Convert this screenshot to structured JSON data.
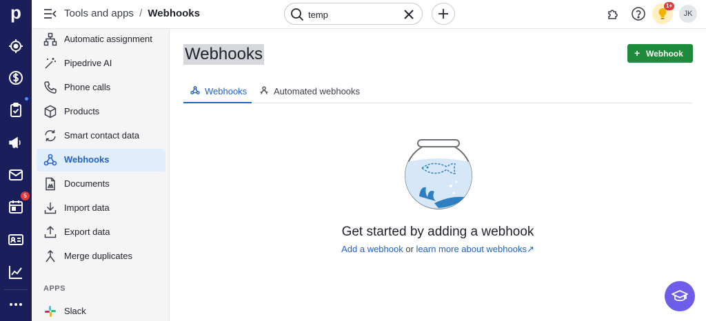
{
  "rail": {
    "logo": "p",
    "items": [
      {
        "icon": "target-icon"
      },
      {
        "icon": "dollar-icon"
      },
      {
        "icon": "clipboard-check-icon"
      },
      {
        "icon": "megaphone-icon"
      },
      {
        "icon": "mail-icon"
      },
      {
        "icon": "calendar-icon",
        "badge": "5"
      },
      {
        "icon": "contact-card-icon"
      },
      {
        "icon": "chart-icon"
      },
      {
        "icon": "more-icon"
      }
    ]
  },
  "header": {
    "breadcrumb_parent": "Tools and apps",
    "breadcrumb_separator": "/",
    "breadcrumb_current": "Webhooks",
    "search_value": "temp",
    "notification_badge": "1+",
    "avatar_initials": "JK"
  },
  "sidebar": {
    "items": [
      {
        "label": "Automatic assignment",
        "icon": "hierarchy-icon"
      },
      {
        "label": "Pipedrive AI",
        "icon": "magic-wand-icon"
      },
      {
        "label": "Phone calls",
        "icon": "phone-icon"
      },
      {
        "label": "Products",
        "icon": "box-icon"
      },
      {
        "label": "Smart contact data",
        "icon": "sync-icon"
      },
      {
        "label": "Webhooks",
        "icon": "webhook-icon",
        "active": true
      },
      {
        "label": "Documents",
        "icon": "document-icon"
      },
      {
        "label": "Import data",
        "icon": "download-icon"
      },
      {
        "label": "Export data",
        "icon": "upload-icon"
      },
      {
        "label": "Merge duplicates",
        "icon": "merge-icon"
      }
    ],
    "apps_heading": "APPS",
    "apps": [
      {
        "label": "Slack",
        "icon": "slack-icon"
      }
    ]
  },
  "main": {
    "title": "Webhooks",
    "cta_label": "Webhook",
    "tabs": [
      {
        "label": "Webhooks",
        "active": true
      },
      {
        "label": "Automated webhooks",
        "active": false
      }
    ],
    "empty_title": "Get started by adding a webhook",
    "empty_link_add": "Add a webhook",
    "empty_or": " or ",
    "empty_link_learn": "learn more about webhooks",
    "empty_link_arrow": "↗"
  },
  "colors": {
    "rail": "#1a1f5b",
    "accent": "#2160c4",
    "cta": "#1e8a3b",
    "fab": "#6e5de8"
  }
}
